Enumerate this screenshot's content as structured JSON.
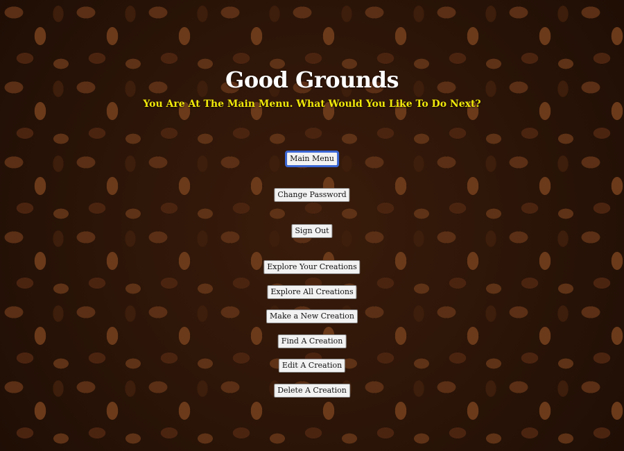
{
  "app": {
    "title": "Good Grounds",
    "subtitle": "You Are At The Main Menu. What Would You Like To Do Next?"
  },
  "menu": {
    "main_menu": "Main Menu",
    "change_password": "Change Password",
    "sign_out": "Sign Out",
    "explore_your_creations": "Explore Your Creations",
    "explore_all_creations": "Explore All Creations",
    "make_new_creation": "Make a New Creation",
    "find_creation": "Find A Creation",
    "edit_creation": "Edit A Creation",
    "delete_creation": "Delete A Creation"
  },
  "colors": {
    "title": "#ffffff",
    "subtitle": "#f0e80a",
    "focus_ring": "#3b68d6",
    "background": "#2a1509"
  }
}
